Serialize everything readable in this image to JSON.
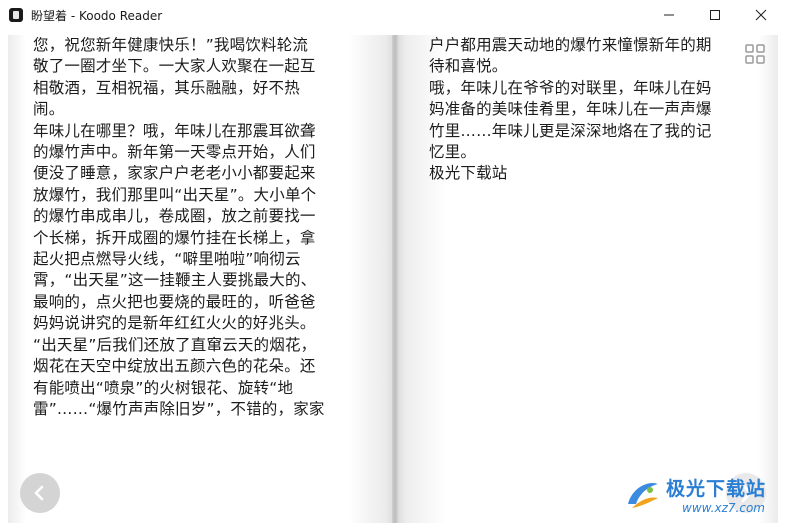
{
  "window": {
    "title": "盼望着 - Koodo Reader",
    "icon": "book-app-icon",
    "controls": [
      "minimize-icon",
      "maximize-icon",
      "close-icon"
    ]
  },
  "reader": {
    "left_page_text": "您，祝您新年健康快乐！”我喝饮料轮流\n敬了一圈才坐下。一大家人欢聚在一起互\n相敬酒，互相祝福，其乐融融，好不热\n闹。\n年味儿在哪里？哦，年味儿在那震耳欲聋\n的爆竹声中。新年第一天零点开始，人们\n便没了睡意，家家户户老老小小都要起来\n放爆竹，我们那里叫“出天星”。大小单个\n的爆竹串成串儿，卷成圈，放之前要找一\n个长梯，拆开成圈的爆竹挂在长梯上，拿\n起火把点燃导火线，“噼里啪啦”响彻云\n霄，“出天星”这一挂鞭主人要挑最大的、\n最响的，点火把也要烧的最旺的，听爸爸\n妈妈说讲究的是新年红红火火的好兆头。\n“出天星”后我们还放了直窜云天的烟花，\n烟花在天空中绽放出五颜六色的花朵。还\n有能喷出“喷泉”的火树银花、旋转“地\n雷”……“爆竹声声除旧岁”，不错的，家家",
    "right_page_text": "户户都用震天动地的爆竹来憧憬新年的期\n待和喜悦。\n哦，年味儿在爷爷的对联里，年味儿在妈\n妈准备的美味佳肴里，年味儿在一声声爆\n竹里……年味儿更是深深地烙在了我的记\n忆里。\n极光下载站",
    "grid_icon": "grid-view-icon",
    "prev_icon": "chevron-left-icon",
    "next_icon": "chevron-right-icon"
  },
  "watermark": {
    "title": "极光下载站",
    "url": "www.xz7.com"
  }
}
